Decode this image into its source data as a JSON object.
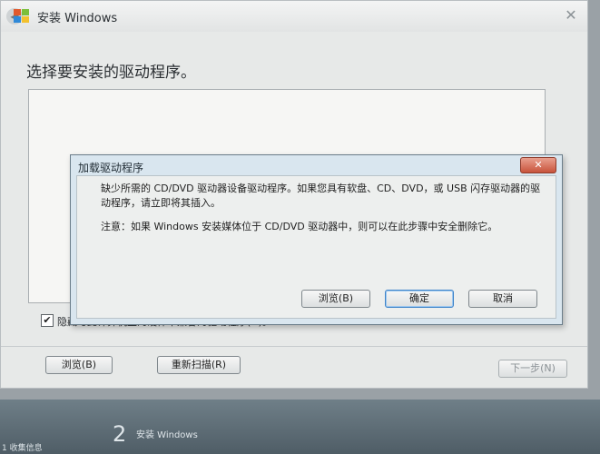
{
  "window": {
    "title": "安装 Windows",
    "heading": "选择要安装的驱动程序。"
  },
  "options": {
    "hide_incompatible_label": "隐藏与此计算机上的硬件不兼容的驱动程序(H)。",
    "hide_incompatible_checked": "✔"
  },
  "buttons": {
    "browse": "浏览(B)",
    "rescan": "重新扫描(R)",
    "next": "下一步(N)"
  },
  "dialog": {
    "title": "加载驱动程序",
    "message": "缺少所需的 CD/DVD 驱动器设备驱动程序。如果您具有软盘、CD、DVD，或 USB 闪存驱动器的驱动程序，请立即将其插入。",
    "note": "注意：如果 Windows 安装媒体位于 CD/DVD 驱动器中，则可以在此步骤中安全删除它。",
    "browse": "浏览(B)",
    "ok": "确定",
    "cancel": "取消",
    "close_glyph": "✕"
  },
  "progress": {
    "step_number": "2",
    "step_label": "安装 Windows",
    "step_caption": "1 收集信息"
  },
  "icons": {
    "back": "back-arrow-icon",
    "window_logo": "windows-flag-icon",
    "close": "close-icon"
  },
  "colors": {
    "dialog_close": "#c8533b",
    "default_button_border": "#3f84c9"
  }
}
